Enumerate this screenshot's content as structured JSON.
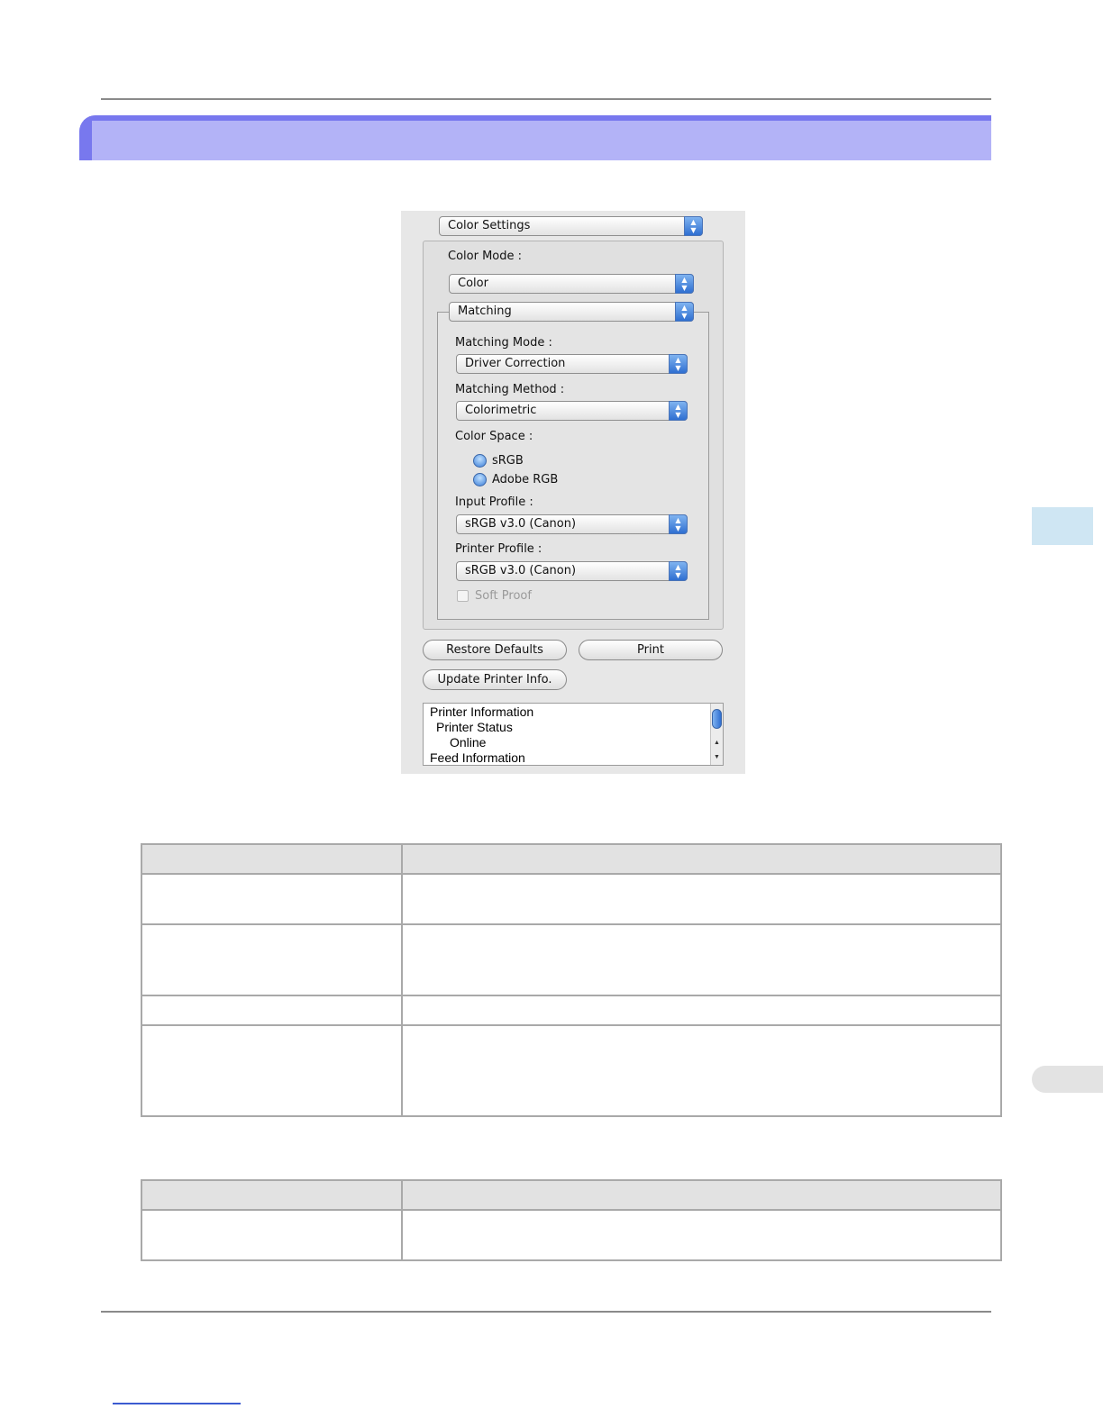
{
  "dialog": {
    "panel_popup": "Color Settings",
    "color_mode_label": "Color Mode :",
    "color_mode_value": "Color",
    "section_popup": "Matching",
    "matching_mode_label": "Matching Mode :",
    "matching_mode_value": "Driver Correction",
    "matching_method_label": "Matching Method :",
    "matching_method_value": "Colorimetric",
    "color_space_label": "Color Space :",
    "color_space_options": [
      "sRGB",
      "Adobe RGB"
    ],
    "input_profile_label": "Input Profile :",
    "input_profile_value": "sRGB v3.0 (Canon)",
    "printer_profile_label": "Printer Profile :",
    "printer_profile_value": "sRGB v3.0 (Canon)",
    "soft_proof_label": "Soft Proof",
    "restore_defaults_label": "Restore Defaults",
    "print_label": "Print",
    "update_printer_info_label": "Update Printer Info.",
    "printer_info_list": [
      "Printer Information",
      "Printer Status",
      "Online",
      "Feed Information"
    ]
  },
  "colors": {
    "banner": "#b3b3f7",
    "banner_edge": "#7878ee",
    "side_tab": "#cfe6f3",
    "link_underline": "#3c5bd1"
  }
}
